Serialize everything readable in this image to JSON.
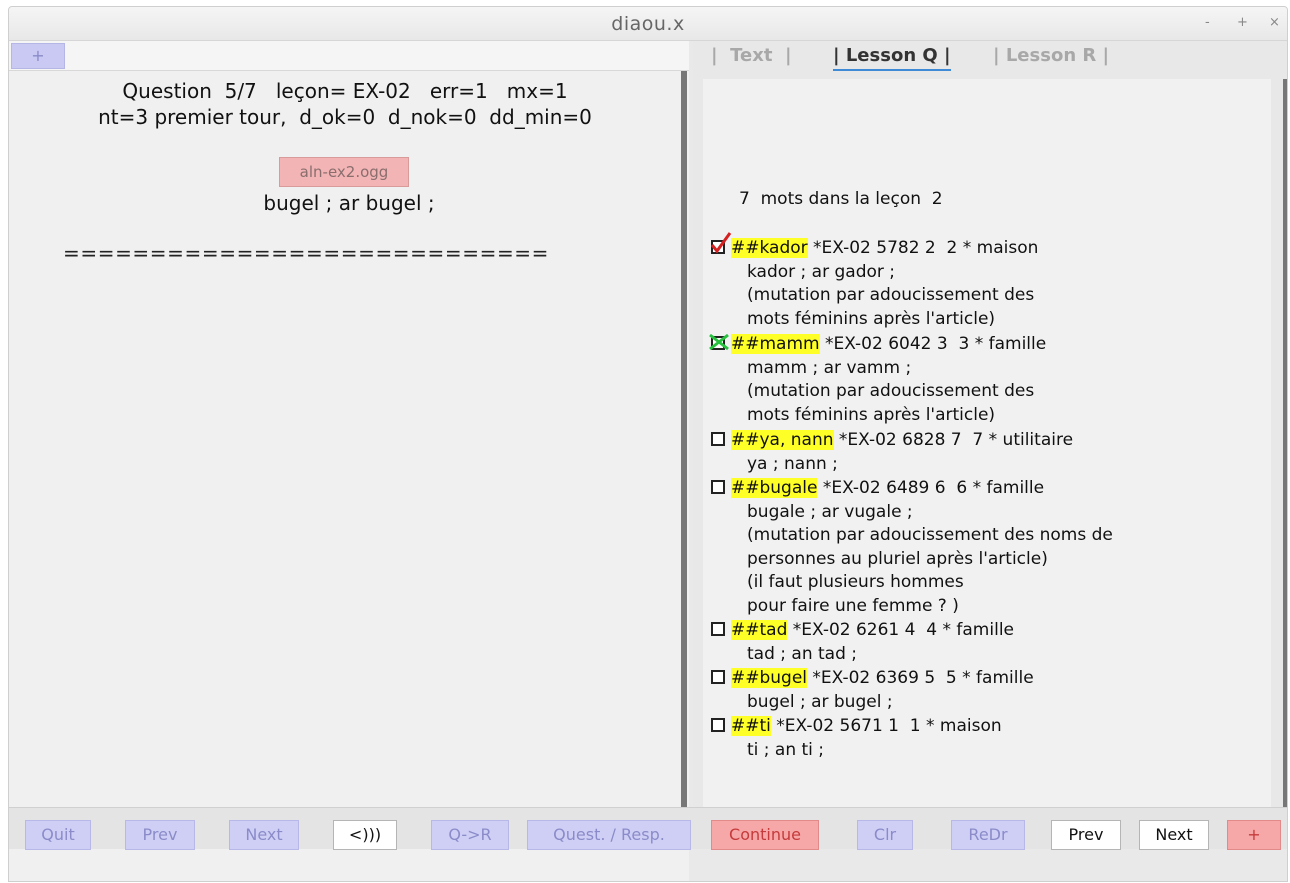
{
  "window": {
    "title": "diaou.x",
    "controls": [
      "-",
      "+",
      "×"
    ]
  },
  "left": {
    "plus_tab": "+",
    "question_line1": "Question  5/7   leçon= EX-02   err=1   mx=1",
    "question_line2": "nt=3 premier tour,  d_ok=0  d_nok=0  dd_min=0",
    "audio_button": "aln-ex2.ogg",
    "answer": "bugel ; ar bugel ;",
    "separator": "============================"
  },
  "right": {
    "tabs": [
      "|  Text  |",
      "| Lesson Q |",
      "| Lesson R |"
    ],
    "count_line": "7  mots dans la leçon  2",
    "entries": [
      {
        "word": "##kador",
        "info": " *EX-02 5782 2  2 * maison",
        "state": "checked-red",
        "lines": [
          "kador ; ar gador ;",
          "(mutation par adoucissement des",
          "mots féminins après l'article)"
        ]
      },
      {
        "word": "##mamm",
        "info": " *EX-02 6042 3  3 * famille",
        "state": "crossed-green",
        "lines": [
          "mamm ; ar vamm ;",
          "(mutation par adoucissement des",
          "mots féminins après l'article)"
        ]
      },
      {
        "word": "##ya, nann",
        "info": " *EX-02 6828 7  7 * utilitaire",
        "state": "empty",
        "lines": [
          "ya ; nann ;"
        ]
      },
      {
        "word": "##bugale",
        "info": " *EX-02 6489 6  6 * famille",
        "state": "empty",
        "lines": [
          "bugale ; ar vugale ;",
          "(mutation par adoucissement des noms de",
          "personnes au pluriel après l'article)",
          "(il faut plusieurs hommes",
          "pour faire une femme ? )"
        ]
      },
      {
        "word": "##tad",
        "info": " *EX-02 6261 4  4 * famille",
        "state": "empty",
        "lines": [
          "tad ; an tad ;"
        ]
      },
      {
        "word": "##bugel",
        "info": " *EX-02 6369 5  5 * famille",
        "state": "empty",
        "lines": [
          "bugel ; ar bugel ;"
        ]
      },
      {
        "word": "##ti",
        "info": " *EX-02 5671 1  1 * maison",
        "state": "empty",
        "lines": [
          "ti ; an ti ;"
        ]
      }
    ]
  },
  "bottom": {
    "quit": "Quit",
    "prev_left": "Prev",
    "next_left": "Next",
    "audio": "<)))",
    "q_to_r": "Q->R",
    "quest_resp": "Quest. / Resp.",
    "continue": "Continue",
    "clr": "Clr",
    "redr": "ReDr",
    "prev_right": "Prev",
    "next_right": "Next",
    "plus": "+"
  },
  "colors": {
    "highlight": "#ffff28",
    "check_red": "#d62020",
    "cross_green": "#27c13f",
    "tab_underline": "#3f8ad6"
  }
}
